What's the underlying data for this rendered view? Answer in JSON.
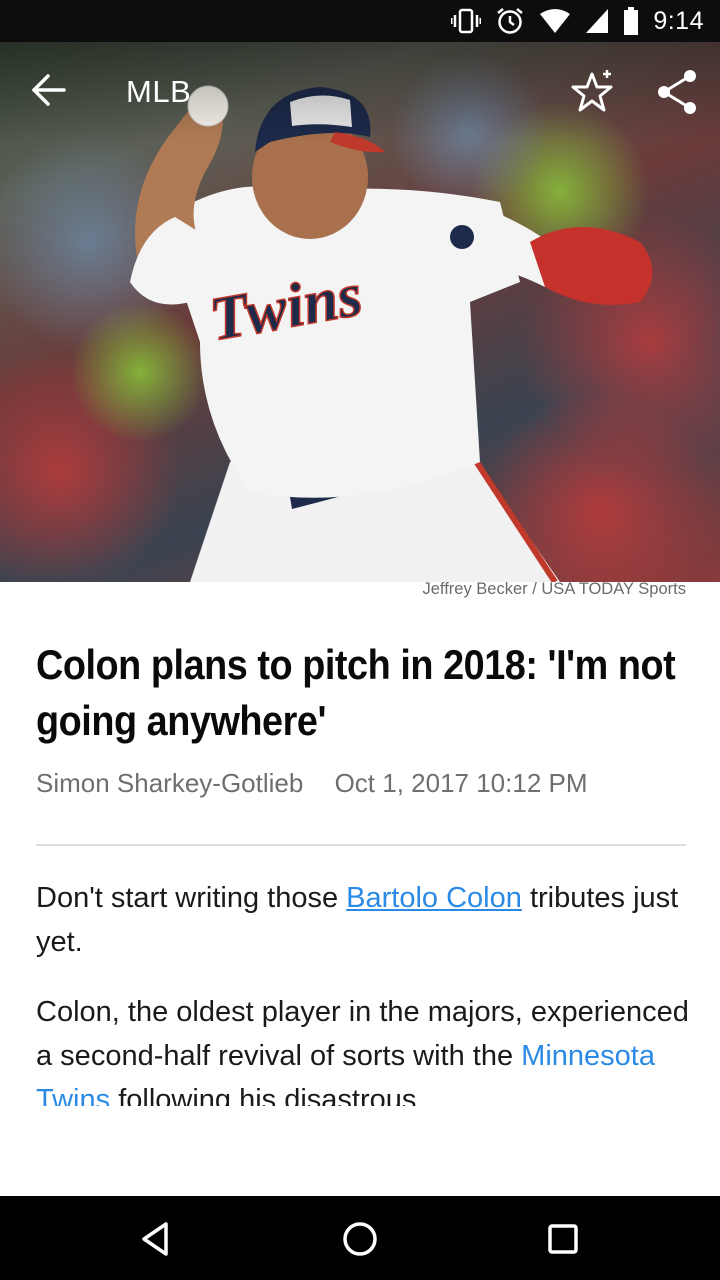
{
  "status_bar": {
    "time": "9:14",
    "icons": [
      "vibrate-icon",
      "alarm-icon",
      "wifi-icon",
      "cell-signal-icon",
      "battery-icon"
    ]
  },
  "toolbar": {
    "back_icon": "arrow-left-icon",
    "section_title": "MLB",
    "favorite_icon": "star-plus-icon",
    "share_icon": "share-icon"
  },
  "hero": {
    "subject": "baseball pitcher in Twins jersey",
    "jersey_text": "Twins",
    "caption": "Jeffrey Becker / USA TODAY Sports"
  },
  "article": {
    "headline": "Colon plans to pitch in 2018: 'I'm not going anywhere'",
    "author": "Simon Sharkey-Gotlieb",
    "date": "Oct 1, 2017 10:12 PM",
    "p1_before": "Don't start writing those ",
    "p1_link": "Bartolo Colon",
    "p1_after": " tributes just yet.",
    "p2_before": "Colon, the oldest player in the majors, experienced a second-half revival of sorts with the ",
    "p2_link": "Minnesota Twins",
    "p2_after": " following his disastrous"
  },
  "colors": {
    "link": "#2b8ae6",
    "status_bar_bg": "#0d0d0d",
    "nav_bar_bg": "#000000"
  },
  "nav_bar": {
    "icons": [
      "back-triangle-icon",
      "home-circle-icon",
      "recents-square-icon"
    ]
  }
}
